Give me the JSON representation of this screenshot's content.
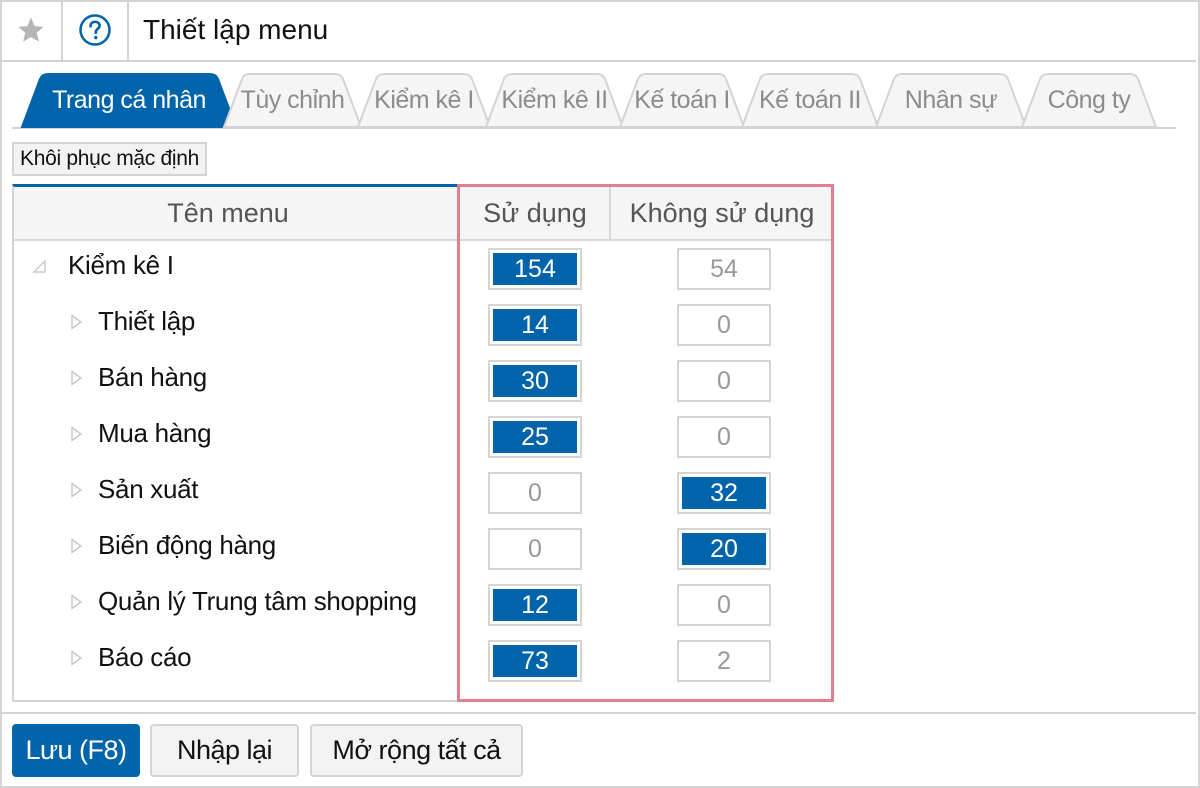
{
  "header": {
    "title": "Thiết lập menu",
    "favorite_icon": "star-icon",
    "help_icon": "help-circle-icon"
  },
  "tabs": [
    {
      "label": "Trang cá nhân",
      "active": true
    },
    {
      "label": "Tùy chỉnh",
      "active": false
    },
    {
      "label": "Kiểm kê I",
      "active": false
    },
    {
      "label": "Kiểm kê II",
      "active": false
    },
    {
      "label": "Kế toán I",
      "active": false
    },
    {
      "label": "Kế toán II",
      "active": false
    },
    {
      "label": "Nhân sự",
      "active": false
    },
    {
      "label": "Công ty",
      "active": false
    }
  ],
  "toolbar": {
    "restore_default_label": "Khôi phục mặc định"
  },
  "table": {
    "columns": {
      "name": "Tên menu",
      "in_use": "Sử dụng",
      "not_in_use": "Không sử dụng"
    },
    "rows": [
      {
        "name": "Kiểm kê I",
        "level": 0,
        "expanded": true,
        "in_use": "154",
        "not_in_use": "54",
        "selected": "in_use"
      },
      {
        "name": "Thiết lập",
        "level": 1,
        "expanded": false,
        "in_use": "14",
        "not_in_use": "0",
        "selected": "in_use"
      },
      {
        "name": "Bán hàng",
        "level": 1,
        "expanded": false,
        "in_use": "30",
        "not_in_use": "0",
        "selected": "in_use"
      },
      {
        "name": "Mua hàng",
        "level": 1,
        "expanded": false,
        "in_use": "25",
        "not_in_use": "0",
        "selected": "in_use"
      },
      {
        "name": "Sản xuất",
        "level": 1,
        "expanded": false,
        "in_use": "0",
        "not_in_use": "32",
        "selected": "not_in_use"
      },
      {
        "name": "Biến động hàng",
        "level": 1,
        "expanded": false,
        "in_use": "0",
        "not_in_use": "20",
        "selected": "not_in_use"
      },
      {
        "name": "Quản lý Trung tâm shopping",
        "level": 1,
        "expanded": false,
        "in_use": "12",
        "not_in_use": "0",
        "selected": "in_use"
      },
      {
        "name": "Báo cáo",
        "level": 1,
        "expanded": false,
        "in_use": "73",
        "not_in_use": "2",
        "selected": "in_use"
      }
    ]
  },
  "footer": {
    "save_label": "Lưu (F8)",
    "reset_label": "Nhập lại",
    "expand_all_label": "Mở rộng tất cả"
  },
  "colors": {
    "accent": "#0064aa",
    "highlight_border": "#e0808e",
    "border": "#d4d4d4",
    "inactive_text": "#8c8c8c"
  }
}
